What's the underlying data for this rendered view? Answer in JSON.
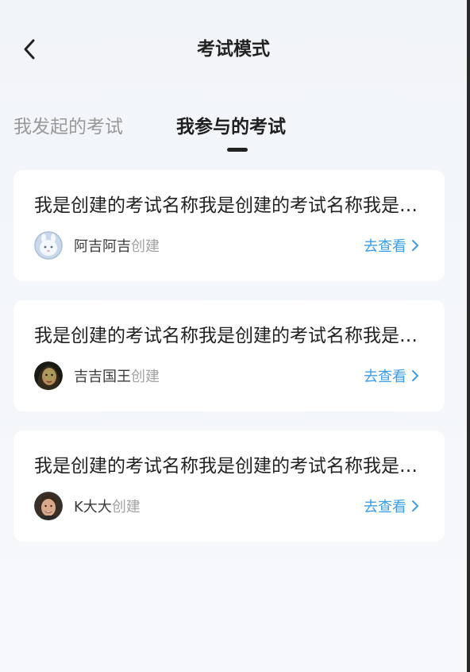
{
  "header": {
    "title": "考试模式",
    "back_icon": "chevron-left-icon"
  },
  "tabs": [
    {
      "label": "我发起的考试",
      "active": false
    },
    {
      "label": "我参与的考试",
      "active": true
    }
  ],
  "exams": [
    {
      "title": "我是创建的考试名称我是创建的考试名称我是创建的考试名称",
      "creator": "阿吉阿吉",
      "created_suffix": "创建",
      "view_label": "去查看",
      "avatar": "avatar-white-rabbit"
    },
    {
      "title": "我是创建的考试名称我是创建的考试名称我是创建的考试名称",
      "creator": "吉吉国王",
      "created_suffix": "创建",
      "view_label": "去查看",
      "avatar": "avatar-woman-portrait"
    },
    {
      "title": "我是创建的考试名称我是创建的考试名称我是创建的考试名称",
      "creator": "K大大",
      "created_suffix": "创建",
      "view_label": "去查看",
      "avatar": "avatar-man-portrait"
    }
  ],
  "colors": {
    "accent": "#3a9ee8",
    "title_text": "#222222",
    "muted_text": "#999999",
    "card_background": "#ffffff"
  }
}
